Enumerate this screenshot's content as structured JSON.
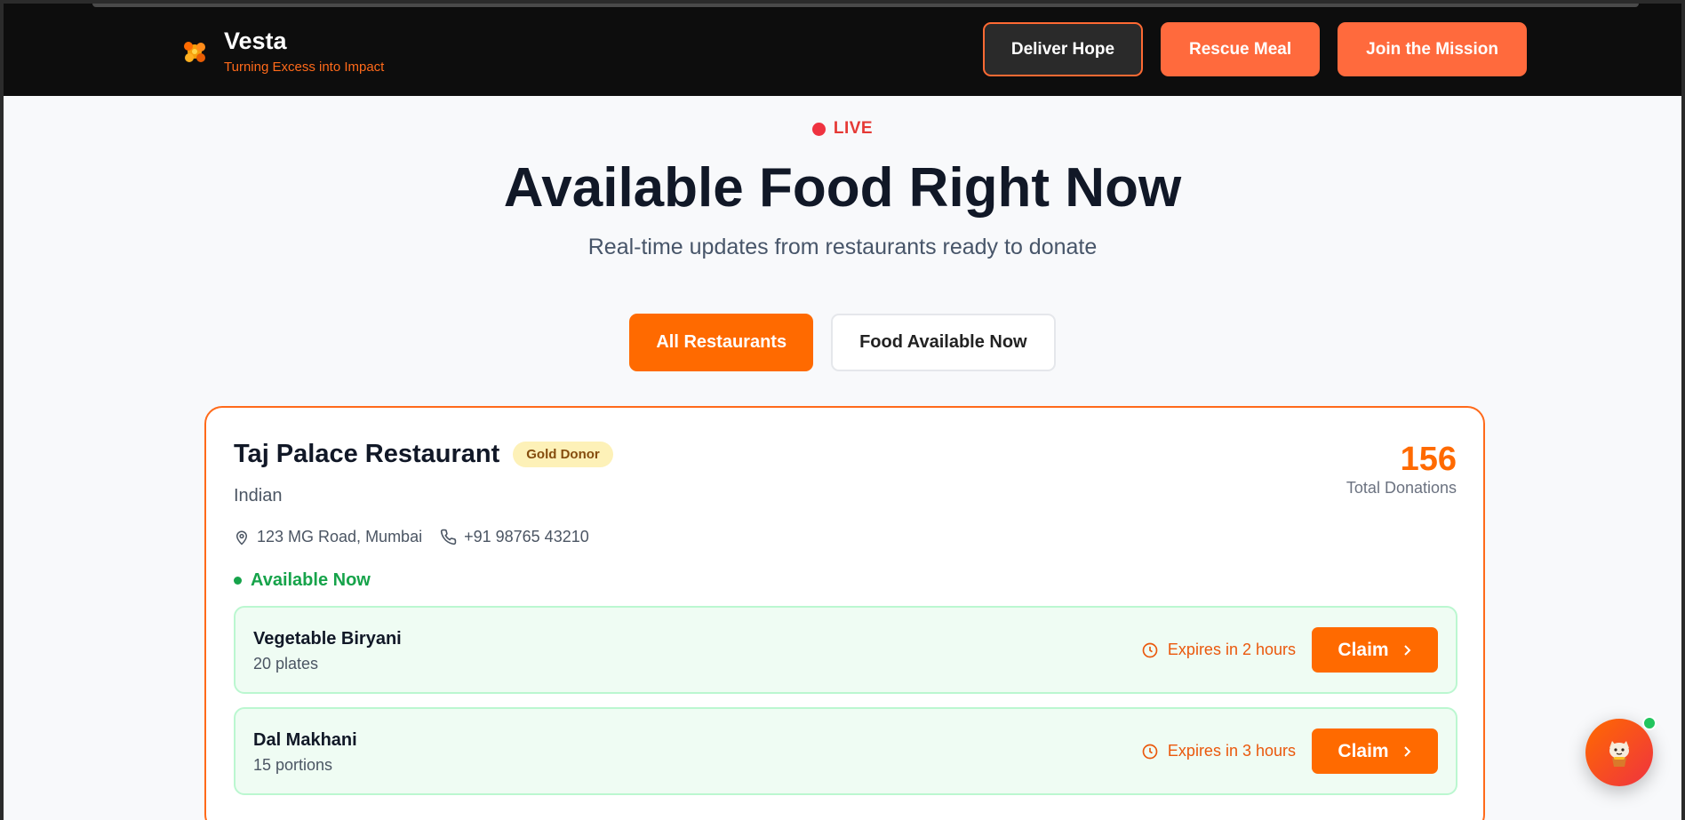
{
  "brand": {
    "name": "Vesta",
    "tagline": "Turning Excess into Impact"
  },
  "nav": {
    "deliver": "Deliver Hope",
    "rescue": "Rescue Meal",
    "join": "Join the Mission"
  },
  "hero": {
    "live": "LIVE",
    "title": "Available Food Right Now",
    "subtitle": "Real-time updates from restaurants ready to donate"
  },
  "filters": {
    "all": "All Restaurants",
    "available": "Food Available Now",
    "active": "All Restaurants"
  },
  "restaurant": {
    "name": "Taj Palace Restaurant",
    "badge": "Gold Donor",
    "cuisine": "Indian",
    "address": "123 MG Road, Mumbai",
    "phone": "+91 98765 43210",
    "availability": "Available Now",
    "total_donations": "156",
    "total_donations_label": "Total Donations",
    "items": [
      {
        "name": "Vegetable Biryani",
        "quantity": "20 plates",
        "expires": "Expires in 2 hours",
        "claim": "Claim"
      },
      {
        "name": "Dal Makhani",
        "quantity": "15 portions",
        "expires": "Expires in 3 hours",
        "claim": "Claim"
      }
    ]
  },
  "colors": {
    "accent": "#ff6a00",
    "live": "#ef3340",
    "available": "#16a34a",
    "header_bg": "#0d0d0d"
  }
}
